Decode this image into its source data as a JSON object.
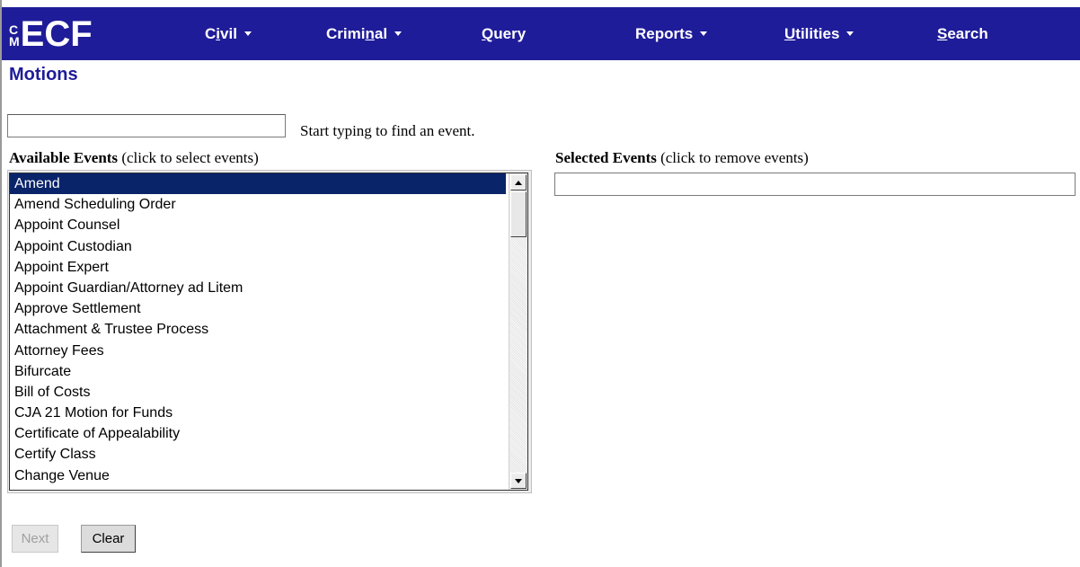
{
  "app": {
    "logo_cm": [
      "C",
      "M"
    ],
    "logo_ecf": "ECF"
  },
  "nav": {
    "civil": {
      "pre": "C",
      "ul": "i",
      "post": "vil"
    },
    "criminal": {
      "pre": "Crimi",
      "ul": "n",
      "post": "al"
    },
    "query": {
      "pre": "",
      "ul": "Q",
      "post": "uery"
    },
    "reports": {
      "pre": "Reports",
      "ul": "",
      "post": ""
    },
    "utilities": {
      "pre": "",
      "ul": "U",
      "post": "tilities"
    },
    "search": {
      "pre": "",
      "ul": "S",
      "post": "earch"
    }
  },
  "page": {
    "title": "Motions",
    "search_hint": "Start typing to find an event.",
    "search_value": "",
    "available_bold": "Available Events",
    "available_rest": " (click to select events)",
    "selected_bold": "Selected Events",
    "selected_rest": " (click to remove events)"
  },
  "available_events": [
    "Amend",
    "Amend Scheduling Order",
    "Appoint Counsel",
    "Appoint Custodian",
    "Appoint Expert",
    "Appoint Guardian/Attorney ad Litem",
    "Approve Settlement",
    "Attachment & Trustee Process",
    "Attorney Fees",
    "Bifurcate",
    "Bill of Costs",
    "CJA 21 Motion for Funds",
    "Certificate of Appealability",
    "Certify Class",
    "Change Venue"
  ],
  "selected_index": 0,
  "buttons": {
    "next": "Next",
    "clear": "Clear"
  },
  "colors": {
    "navbar": "#1f1c99",
    "selection": "#0a246a"
  }
}
